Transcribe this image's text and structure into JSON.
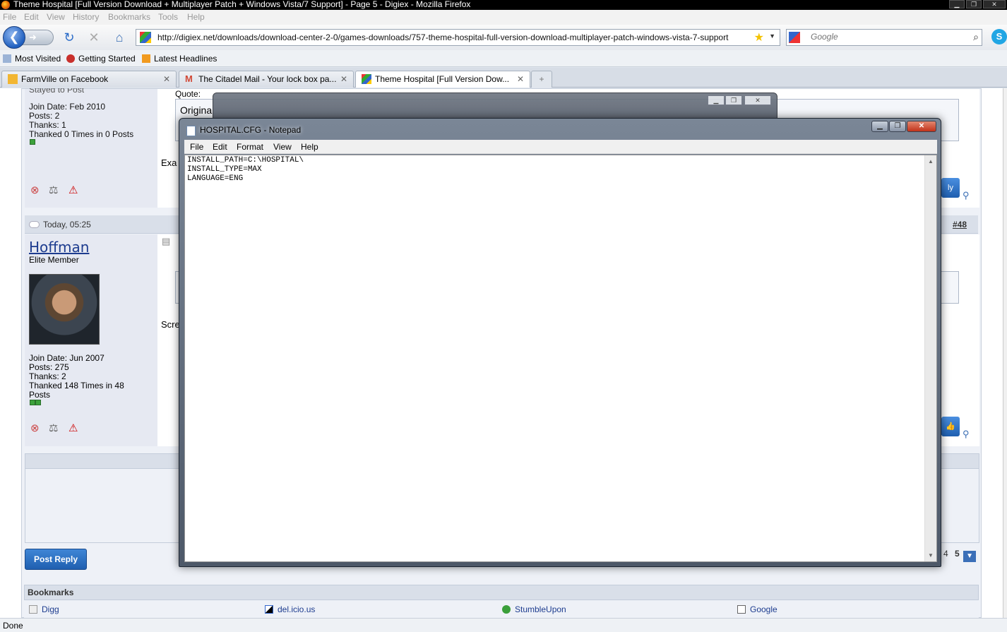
{
  "browser": {
    "window_title": "Theme Hospital [Full Version Download + Multiplayer Patch + Windows Vista/7 Support] - Page 5 - Digiex - Mozilla Firefox",
    "window_buttons": {
      "minimize": "▁",
      "restore": "❐",
      "close": "✕"
    },
    "menu": [
      "File",
      "Edit",
      "View",
      "History",
      "Bookmarks",
      "Tools",
      "Help"
    ],
    "nav": {
      "back_icon": "back-arrow-icon",
      "forward_icon": "forward-arrow-icon",
      "reload_icon": "reload-icon",
      "stop_icon": "stop-icon",
      "home_icon": "home-icon"
    },
    "url": "http://digiex.net/downloads/download-center-2-0/games-downloads/757-theme-hospital-full-version-download-multiplayer-patch-windows-vista-7-support",
    "search_placeholder": "Google",
    "bookmarks_toolbar": [
      "Most Visited",
      "Getting Started",
      "Latest Headlines"
    ],
    "tabs": [
      {
        "label": "FarmVille on Facebook",
        "active": false
      },
      {
        "label": "The Citadel Mail - Your lock box pa...",
        "active": false
      },
      {
        "label": "Theme Hospital [Full Version Dow...",
        "active": true
      }
    ],
    "new_tab_label": "+",
    "status": "Done"
  },
  "forum": {
    "post1": {
      "cut_line": "Stayed to Post",
      "join_date": "Join Date: Feb 2010",
      "posts": "Posts: 2",
      "thanks": "Thanks: 1",
      "thanked": "Thanked 0 Times in 0 Posts",
      "quote_label": "Quote:",
      "quote_text": "Origina",
      "extra_text": "Exa"
    },
    "post2": {
      "date": "Today, 05:25",
      "number": "#48",
      "username": "Hoffman",
      "rank": "Elite Member",
      "join_date": "Join Date: Jun 2007",
      "posts": "Posts: 275",
      "thanks": "Thanks: 2",
      "thanked_1": "Thanked 148 Times in 48",
      "thanked_2": "Posts",
      "body_partial": "Scre"
    },
    "post_reply_label": "Post Reply",
    "pager": {
      "pages": [
        "4",
        "5"
      ],
      "current": "5"
    },
    "side_reply_partial": "ly",
    "bookmarks_title": "Bookmarks",
    "bookmarks": [
      "Digg",
      "del.icio.us",
      "StumbleUpon",
      "Google"
    ]
  },
  "notepad": {
    "title": "HOSPITAL.CFG - Notepad",
    "menu": [
      "File",
      "Edit",
      "Format",
      "View",
      "Help"
    ],
    "content": "INSTALL_PATH=C:\\HOSPITAL\\\nINSTALL_TYPE=MAX\nLANGUAGE=ENG",
    "buttons": {
      "minimize": "▁",
      "maximize": "❐",
      "close": "✕"
    }
  }
}
